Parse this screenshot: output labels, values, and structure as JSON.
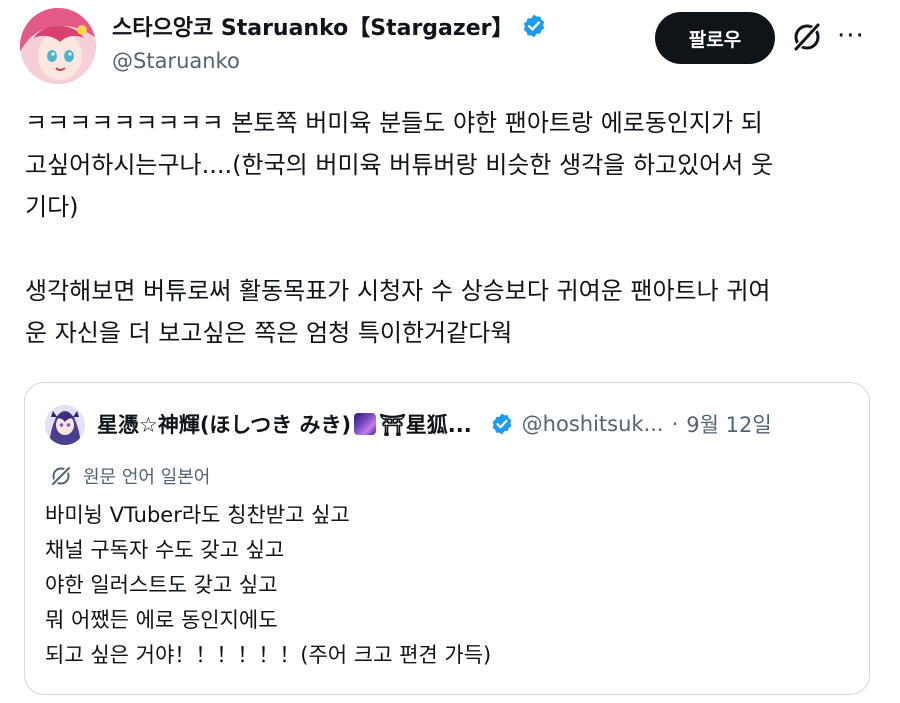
{
  "author": {
    "display_name": "스타으앙코 Staruanko【Stargazer】",
    "handle": "@Staruanko",
    "verified": true
  },
  "actions": {
    "follow_label": "팔로우",
    "grok_icon": "grok-icon",
    "more_icon": "more-icon"
  },
  "tweet": {
    "lines": [
      "ㅋㅋㅋㅋㅋㅋㅋㅋㅋ 본토쪽 버미육 분들도 야한 팬아트랑 에로동인지가 되",
      "고싶어하시는구나....(한국의 버미육 버튜버랑 비슷한 생각을 하고있어서 웃",
      "기다)",
      "생각해보면 버튜로써 활동목표가 시청자 수 상승보다 귀여운 팬아트나 귀여",
      "운 자신을 더 보고싶은 쪽은 엄청 특이한거같다웍"
    ]
  },
  "quoted": {
    "display_name": "星憑☆神輝(ほしつき みき)",
    "name_suffix": "⛩星狐...",
    "handle": "@hoshitsuk...",
    "separator": "·",
    "date": "9월 12일",
    "verified": true,
    "translation_note": "원문 언어 일본어",
    "lines": [
      "바미뉭 VTuber라도 칭찬받고 싶고",
      "채널 구독자 수도 갖고 싶고",
      "야한 일러스트도 갖고 싶고",
      "뭐 어쨌든 에로 동인지에도",
      "되고 싶은 거야！！！！！！(주어 크고 편견 가득)"
    ]
  },
  "colors": {
    "text": "#0f1419",
    "secondary": "#536471",
    "verified": "#1d9bf0",
    "border": "#cfd9de",
    "follow_bg": "#0f1419"
  }
}
